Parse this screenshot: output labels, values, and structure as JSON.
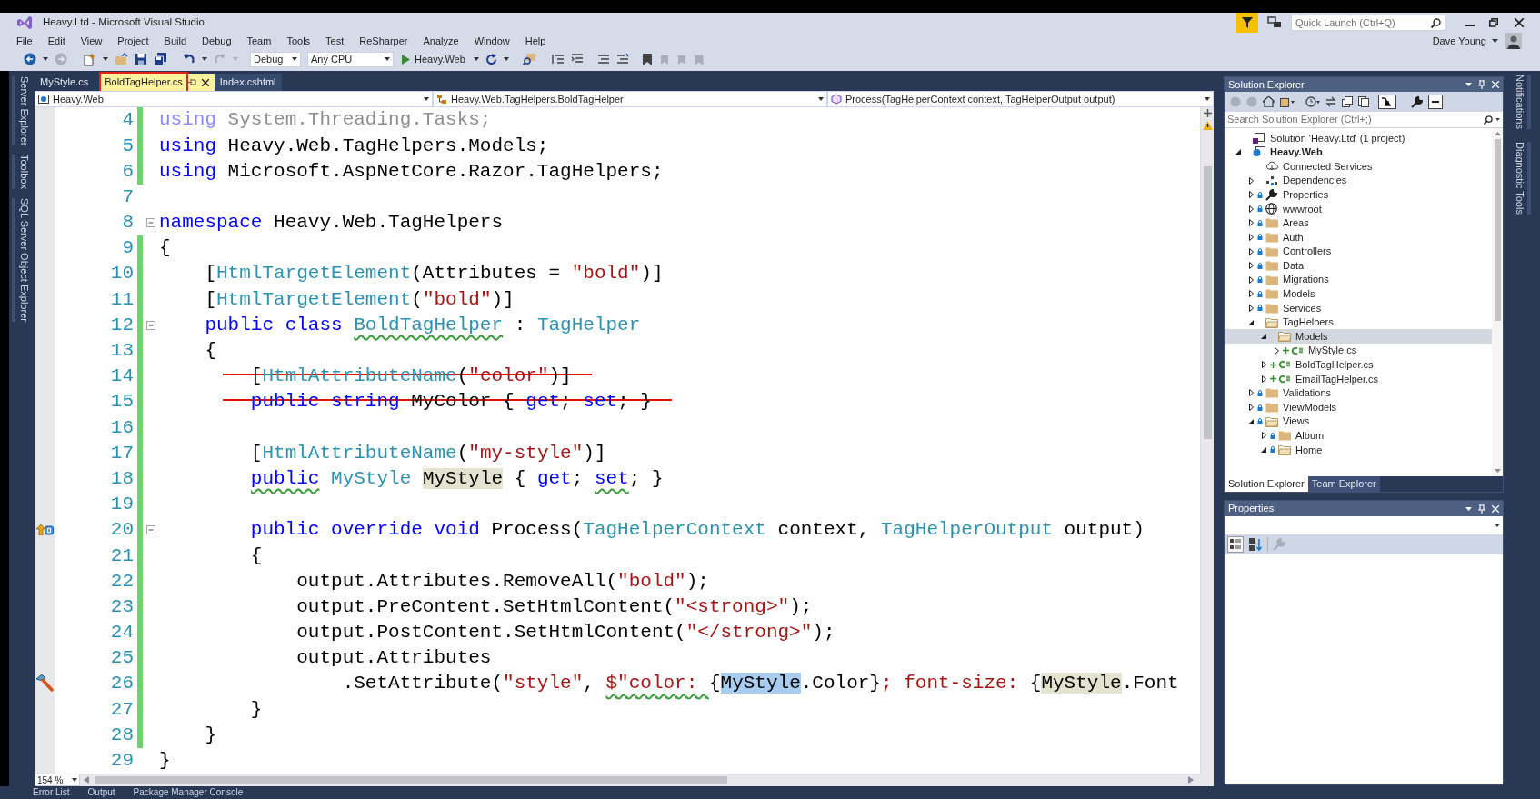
{
  "window": {
    "title": "Heavy.Ltd - Microsoft Visual Studio",
    "quick_launch": {
      "placeholder": "Quick Launch (Ctrl+Q)"
    },
    "user": "Dave Young"
  },
  "menu": [
    "File",
    "Edit",
    "View",
    "Project",
    "Build",
    "Debug",
    "Team",
    "Tools",
    "Test",
    "ReSharper",
    "Analyze",
    "Window",
    "Help"
  ],
  "toolbar": {
    "configuration": "Debug",
    "platform": "Any CPU",
    "start": "Heavy.Web"
  },
  "left_tool_tabs": [
    "Server Explorer",
    "Toolbox",
    "SQL Server Object Explorer"
  ],
  "tabs": [
    {
      "label": "MyStyle.cs",
      "selected": false,
      "outlined": false
    },
    {
      "label": "BoldTagHelper.cs",
      "selected": true,
      "outlined": true
    },
    {
      "label": "Index.cshtml",
      "selected": false,
      "outlined": false
    }
  ],
  "navigation": {
    "project": "Heavy.Web",
    "type": "Heavy.Web.TagHelpers.BoldTagHelper",
    "member": "Process(TagHelperContext context, TagHelperOutput output)"
  },
  "editor": {
    "zoom": "154 %",
    "lines": [
      {
        "number": "4",
        "changed": true,
        "fold": false,
        "struck": false,
        "tokens": [
          {
            "kind": "kwf",
            "text": "using"
          },
          {
            "kind": "f",
            "text": " System.Threading.Tasks;"
          }
        ]
      },
      {
        "number": "5",
        "changed": true,
        "fold": false,
        "struck": false,
        "tokens": [
          {
            "kind": "kw",
            "text": "using"
          },
          {
            "kind": "p",
            "text": " Heavy.Web.TagHelpers.Models;"
          }
        ]
      },
      {
        "number": "6",
        "changed": true,
        "fold": false,
        "struck": false,
        "tokens": [
          {
            "kind": "kw",
            "text": "using"
          },
          {
            "kind": "p",
            "text": " Microsoft.AspNetCore.Razor.TagHelpers;"
          }
        ]
      },
      {
        "number": "7",
        "changed": false,
        "fold": false,
        "struck": false
      },
      {
        "number": "8",
        "changed": false,
        "fold": true,
        "struck": false,
        "tokens": [
          {
            "kind": "kw",
            "text": "namespace"
          },
          {
            "kind": "p",
            "text": " Heavy.Web.TagHelpers"
          }
        ]
      },
      {
        "number": "9",
        "changed": true,
        "fold": false,
        "struck": false,
        "tokens": [
          {
            "kind": "p",
            "text": "{"
          }
        ]
      },
      {
        "number": "10",
        "changed": true,
        "fold": false,
        "struck": false,
        "tokens": [
          {
            "kind": "p",
            "text": "    ["
          },
          {
            "kind": "type",
            "text": "HtmlTargetElement"
          },
          {
            "kind": "p",
            "text": "(Attributes = "
          },
          {
            "kind": "str",
            "text": "\"bold\""
          },
          {
            "kind": "p",
            "text": ")]"
          }
        ]
      },
      {
        "number": "11",
        "changed": true,
        "fold": false,
        "struck": false,
        "tokens": [
          {
            "kind": "p",
            "text": "    ["
          },
          {
            "kind": "type",
            "text": "HtmlTargetElement"
          },
          {
            "kind": "p",
            "text": "("
          },
          {
            "kind": "str",
            "text": "\"bold\""
          },
          {
            "kind": "p",
            "text": ")]"
          }
        ]
      },
      {
        "number": "12",
        "changed": true,
        "fold": true,
        "struck": false,
        "tokens": [
          {
            "kind": "kw",
            "text": "    public"
          },
          {
            "kind": "kw",
            "text": " class "
          },
          {
            "kind": "type",
            "text": "BoldTagHelper",
            "squiggle": true
          },
          {
            "kind": "p",
            "text": " : "
          },
          {
            "kind": "type",
            "text": "TagHelper"
          }
        ]
      },
      {
        "number": "13",
        "changed": true,
        "fold": false,
        "struck": false,
        "tokens": [
          {
            "kind": "p",
            "text": "    {"
          }
        ]
      },
      {
        "number": "14",
        "changed": true,
        "fold": false,
        "struck": true,
        "tokens": [
          {
            "kind": "p",
            "text": "        ["
          },
          {
            "kind": "type",
            "text": "HtmlAttributeName"
          },
          {
            "kind": "p",
            "text": "("
          },
          {
            "kind": "str",
            "text": "\"color\""
          },
          {
            "kind": "p",
            "text": ")]"
          }
        ]
      },
      {
        "number": "15",
        "changed": true,
        "fold": false,
        "struck": true,
        "tokens": [
          {
            "kind": "kw",
            "text": "        public"
          },
          {
            "kind": "kw",
            "text": " string"
          },
          {
            "kind": "p",
            "text": " MyColor { "
          },
          {
            "kind": "kw",
            "text": "get"
          },
          {
            "kind": "p",
            "text": "; "
          },
          {
            "kind": "kw",
            "text": "set"
          },
          {
            "kind": "p",
            "text": "; }"
          }
        ]
      },
      {
        "number": "16",
        "changed": true,
        "fold": false,
        "struck": false
      },
      {
        "number": "17",
        "changed": true,
        "fold": false,
        "struck": false,
        "tokens": [
          {
            "kind": "p",
            "text": "        ["
          },
          {
            "kind": "type",
            "text": "HtmlAttributeName"
          },
          {
            "kind": "p",
            "text": "("
          },
          {
            "kind": "str",
            "text": "\"my-style\""
          },
          {
            "kind": "p",
            "text": ")]"
          }
        ]
      },
      {
        "number": "18",
        "changed": true,
        "fold": false,
        "struck": false,
        "tokens": [
          {
            "kind": "kw",
            "text": "        public",
            "squiggle": true
          },
          {
            "kind": "type",
            "text": " MyStyle "
          },
          {
            "kind": "p",
            "text": "MyStyle",
            "referenced": true
          },
          {
            "kind": "p",
            "text": " { "
          },
          {
            "kind": "kw",
            "text": "get"
          },
          {
            "kind": "p",
            "text": "; "
          },
          {
            "kind": "kw",
            "text": "set",
            "squiggle": true
          },
          {
            "kind": "p",
            "text": "; }"
          }
        ]
      },
      {
        "number": "19",
        "changed": true,
        "fold": false,
        "struck": false
      },
      {
        "number": "20",
        "changed": true,
        "fold": true,
        "struck": false,
        "overrides": true,
        "tokens": [
          {
            "kind": "kw",
            "text": "        public"
          },
          {
            "kind": "kw",
            "text": " override"
          },
          {
            "kind": "kw",
            "text": " void"
          },
          {
            "kind": "p",
            "text": " Process("
          },
          {
            "kind": "type",
            "text": "TagHelperContext"
          },
          {
            "kind": "p",
            "text": " context, "
          },
          {
            "kind": "type",
            "text": "TagHelperOutput"
          },
          {
            "kind": "p",
            "text": " output)"
          }
        ]
      },
      {
        "number": "21",
        "changed": true,
        "fold": false,
        "struck": false,
        "tokens": [
          {
            "kind": "p",
            "text": "        {"
          }
        ]
      },
      {
        "number": "22",
        "changed": true,
        "fold": false,
        "struck": false,
        "tokens": [
          {
            "kind": "p",
            "text": "            output.Attributes.RemoveAll("
          },
          {
            "kind": "str",
            "text": "\"bold\""
          },
          {
            "kind": "p",
            "text": ");"
          }
        ]
      },
      {
        "number": "23",
        "changed": true,
        "fold": false,
        "struck": false,
        "tokens": [
          {
            "kind": "p",
            "text": "            output.PreContent.SetHtmlContent("
          },
          {
            "kind": "str",
            "text": "\"<strong>\""
          },
          {
            "kind": "p",
            "text": ");"
          }
        ]
      },
      {
        "number": "24",
        "changed": true,
        "fold": false,
        "struck": false,
        "tokens": [
          {
            "kind": "p",
            "text": "            output.PostContent.SetHtmlContent("
          },
          {
            "kind": "str",
            "text": "\"</strong>\""
          },
          {
            "kind": "p",
            "text": ");"
          }
        ]
      },
      {
        "number": "25",
        "changed": true,
        "fold": false,
        "struck": false,
        "tokens": [
          {
            "kind": "p",
            "text": "            output.Attributes"
          }
        ]
      },
      {
        "number": "26",
        "changed": true,
        "fold": false,
        "struck": false,
        "quick_action": true,
        "tokens": [
          {
            "kind": "p",
            "text": "                .SetAttribute("
          },
          {
            "kind": "str",
            "text": "\"style\""
          },
          {
            "kind": "p",
            "text": ", "
          },
          {
            "kind": "str",
            "text": "$\"color: ",
            "squiggle": true
          },
          {
            "kind": "p",
            "text": "{"
          },
          {
            "kind": "p",
            "text": "MyStyle",
            "selected": true
          },
          {
            "kind": "p",
            "text": ".Color}"
          },
          {
            "kind": "str",
            "text": "; font-size: "
          },
          {
            "kind": "p",
            "text": "{"
          },
          {
            "kind": "p",
            "text": "MyStyle",
            "referenced": true
          },
          {
            "kind": "p",
            "text": ".Font"
          }
        ]
      },
      {
        "number": "27",
        "changed": true,
        "fold": false,
        "struck": false,
        "tokens": [
          {
            "kind": "p",
            "text": "        }"
          }
        ]
      },
      {
        "number": "28",
        "changed": true,
        "fold": false,
        "struck": false,
        "tokens": [
          {
            "kind": "p",
            "text": "    }"
          }
        ]
      },
      {
        "number": "29",
        "changed": false,
        "fold": false,
        "struck": false,
        "tokens": [
          {
            "kind": "p",
            "text": "}"
          }
        ]
      }
    ]
  },
  "solution_explorer": {
    "title": "Solution Explorer",
    "search": {
      "placeholder": "Search Solution Explorer (Ctrl+;)"
    },
    "tree": [
      {
        "label": "Solution 'Heavy.Ltd' (1 project)",
        "kind": "solution",
        "expandable": false,
        "selected": false
      },
      {
        "label": "Heavy.Web",
        "kind": "project",
        "expandable": true,
        "expanded": true,
        "selected": false,
        "children": [
          {
            "label": "Connected Services",
            "kind": "service",
            "expandable": false,
            "selected": false
          },
          {
            "label": "Dependencies",
            "kind": "deps",
            "expandable": true,
            "expanded": false,
            "selected": false
          },
          {
            "label": "Properties",
            "kind": "properties",
            "locked": true,
            "expandable": true,
            "expanded": false,
            "selected": false
          },
          {
            "label": "wwwroot",
            "kind": "globe",
            "locked": true,
            "expandable": true,
            "expanded": false,
            "selected": false
          },
          {
            "label": "Areas",
            "kind": "folder",
            "locked": true,
            "expandable": true,
            "expanded": false,
            "selected": false
          },
          {
            "label": "Auth",
            "kind": "folder",
            "locked": true,
            "expandable": true,
            "expanded": false,
            "selected": false
          },
          {
            "label": "Controllers",
            "kind": "folder",
            "locked": true,
            "expandable": true,
            "expanded": false,
            "selected": false
          },
          {
            "label": "Data",
            "kind": "folder",
            "locked": true,
            "expandable": true,
            "expanded": false,
            "selected": false
          },
          {
            "label": "Migrations",
            "kind": "folder",
            "locked": true,
            "expandable": true,
            "expanded": false,
            "selected": false
          },
          {
            "label": "Models",
            "kind": "folder",
            "locked": true,
            "expandable": true,
            "expanded": false,
            "selected": false
          },
          {
            "label": "Services",
            "kind": "folder",
            "locked": true,
            "expandable": true,
            "expanded": false,
            "selected": false
          },
          {
            "label": "TagHelpers",
            "kind": "folder",
            "expandable": true,
            "expanded": true,
            "selected": false,
            "children": [
              {
                "label": "Models",
                "kind": "folder",
                "expandable": true,
                "expanded": true,
                "selected": true,
                "children": [
                  {
                    "label": "MyStyle.cs",
                    "kind": "cs",
                    "added": true,
                    "expandable": true,
                    "expanded": false,
                    "selected": false
                  }
                ]
              },
              {
                "label": "BoldTagHelper.cs",
                "kind": "cs",
                "added": true,
                "expandable": true,
                "expanded": false,
                "selected": false
              },
              {
                "label": "EmailTagHelper.cs",
                "kind": "cs",
                "added": true,
                "expandable": true,
                "expanded": false,
                "selected": false
              }
            ]
          },
          {
            "label": "Validations",
            "kind": "folder",
            "locked": true,
            "expandable": true,
            "expanded": false,
            "selected": false
          },
          {
            "label": "ViewModels",
            "kind": "folder",
            "locked": true,
            "expandable": true,
            "expanded": false,
            "selected": false
          },
          {
            "label": "Views",
            "kind": "folder",
            "locked": true,
            "expandable": true,
            "expanded": true,
            "selected": false,
            "children": [
              {
                "label": "Album",
                "kind": "folder",
                "locked": true,
                "expandable": true,
                "expanded": false,
                "selected": false
              },
              {
                "label": "Home",
                "kind": "folder",
                "locked": true,
                "expandable": true,
                "expanded": true,
                "selected": false
              }
            ]
          }
        ]
      }
    ],
    "tabs": [
      {
        "label": "Solution Explorer",
        "selected": true
      },
      {
        "label": "Team Explorer",
        "selected": false
      }
    ]
  },
  "properties": {
    "title": "Properties"
  },
  "right_tool_tabs": [
    "Notifications",
    "Diagnostic Tools"
  ],
  "bottom_tabs": [
    "Error List",
    "Output",
    "Package Manager Console"
  ]
}
